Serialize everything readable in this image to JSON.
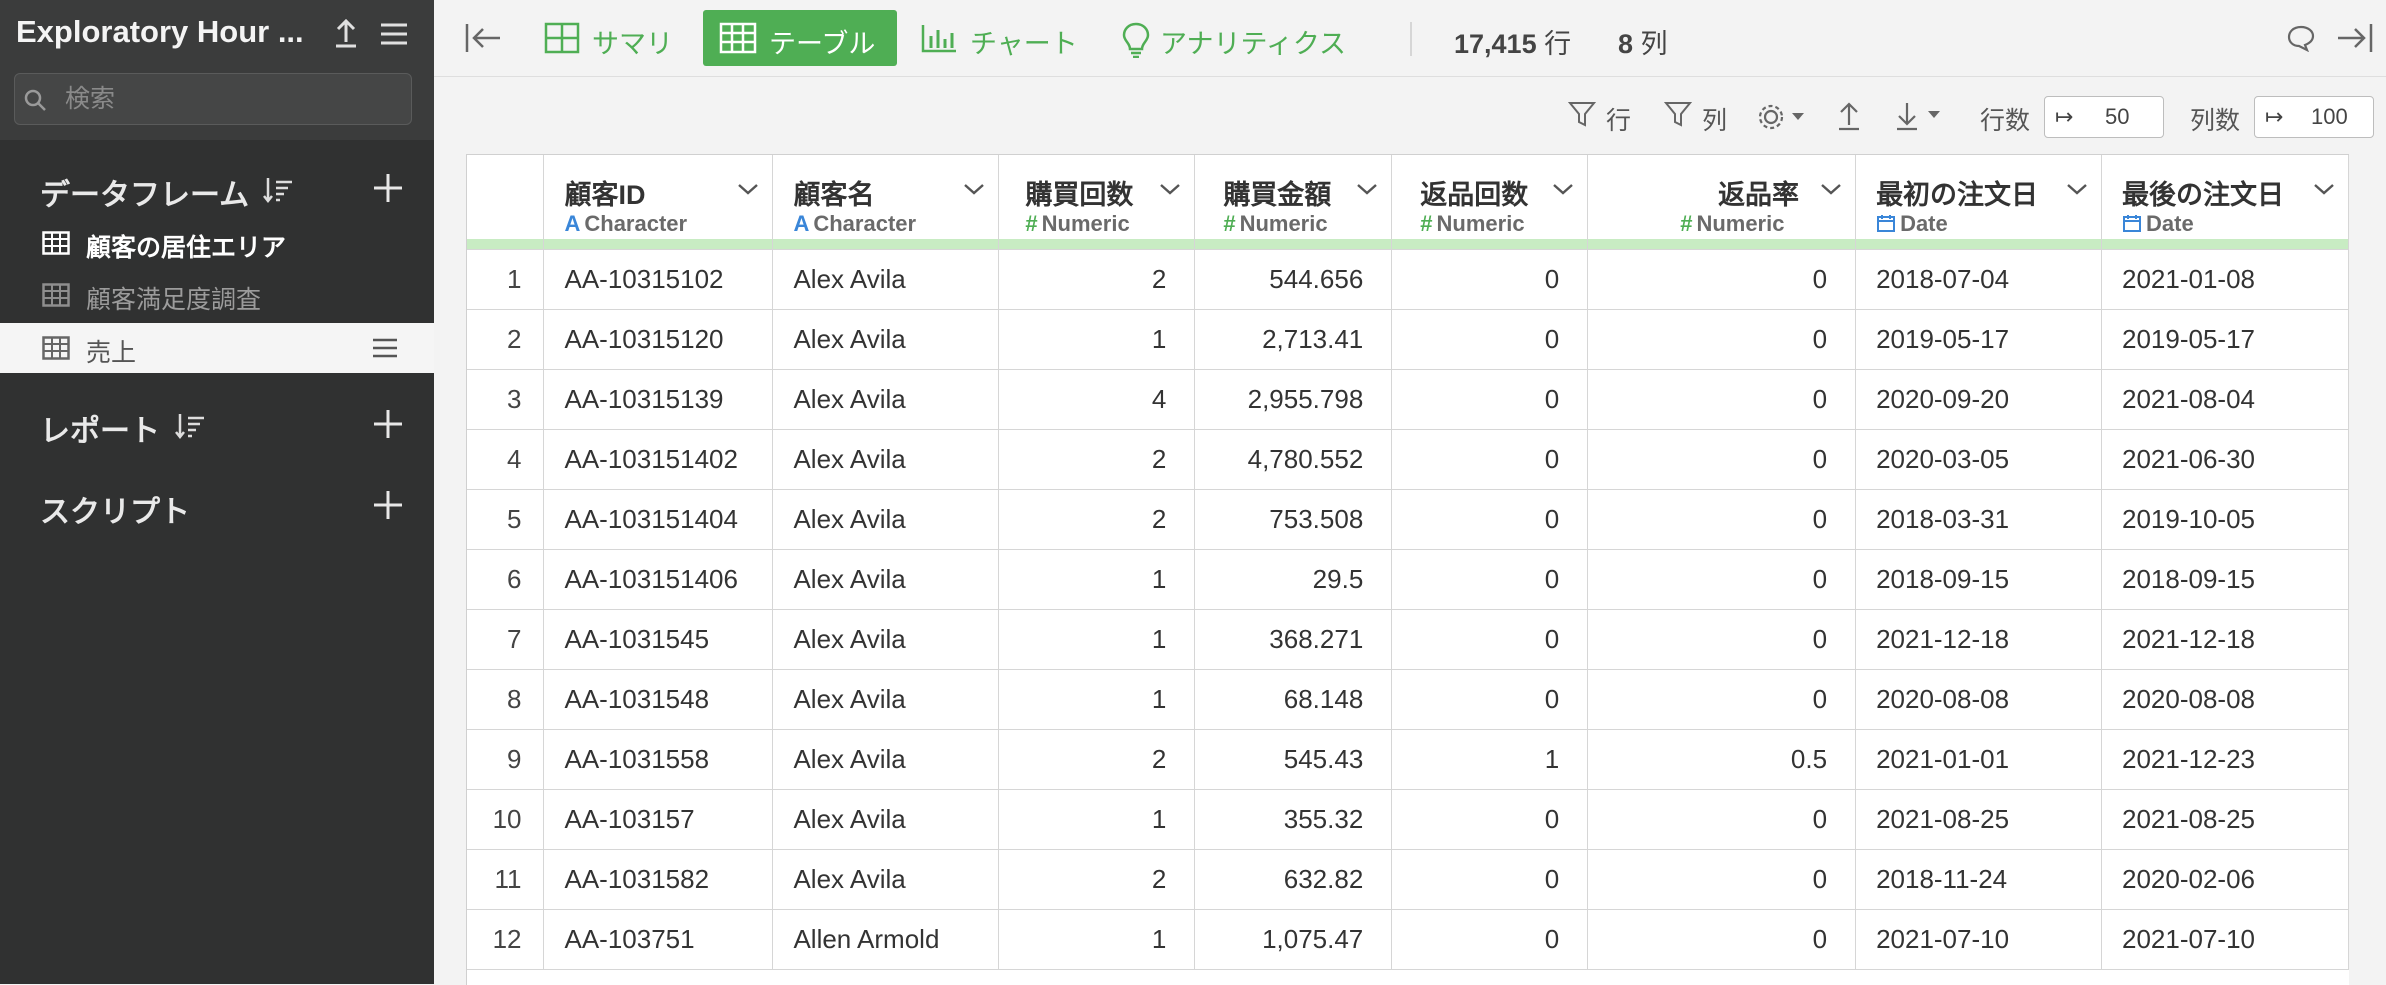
{
  "app": {
    "project_title": "Exploratory Hour ..."
  },
  "sidebar": {
    "search_placeholder": "検索",
    "sections": {
      "dataframes": {
        "title": "データフレーム"
      },
      "reports": {
        "title": "レポート"
      },
      "scripts": {
        "title": "スクリプト"
      }
    },
    "dataframes": [
      {
        "label": "顧客の居住エリア"
      },
      {
        "label": "顧客満足度調査"
      },
      {
        "label": "売上"
      }
    ]
  },
  "toolbar": {
    "tabs": [
      "サマリ",
      "テーブル",
      "チャート",
      "アナリティクス"
    ],
    "active_tab": "テーブル",
    "row_count": "17,415",
    "row_unit": "行",
    "col_count": "8",
    "col_unit": "列"
  },
  "subtoolbar": {
    "row_filter": "行",
    "col_filter": "列",
    "rows_label": "行数",
    "rows_value": "50",
    "cols_label": "列数",
    "cols_value": "100"
  },
  "table": {
    "columns": [
      {
        "name": "顧客ID",
        "type": "Character",
        "type_symbol": "A"
      },
      {
        "name": "顧客名",
        "type": "Character",
        "type_symbol": "A"
      },
      {
        "name": "購買回数",
        "type": "Numeric",
        "type_symbol": "#"
      },
      {
        "name": "購買金額",
        "type": "Numeric",
        "type_symbol": "#"
      },
      {
        "name": "返品回数",
        "type": "Numeric",
        "type_symbol": "#"
      },
      {
        "name": "返品率",
        "type": "Numeric",
        "type_symbol": "#"
      },
      {
        "name": "最初の注文日",
        "type": "Date",
        "type_symbol": "date"
      },
      {
        "name": "最後の注文日",
        "type": "Date",
        "type_symbol": "date"
      }
    ],
    "rows": [
      [
        "1",
        "AA-10315102",
        "Alex Avila",
        "2",
        "544.656",
        "0",
        "0",
        "2018-07-04",
        "2021-01-08"
      ],
      [
        "2",
        "AA-10315120",
        "Alex Avila",
        "1",
        "2,713.41",
        "0",
        "0",
        "2019-05-17",
        "2019-05-17"
      ],
      [
        "3",
        "AA-10315139",
        "Alex Avila",
        "4",
        "2,955.798",
        "0",
        "0",
        "2020-09-20",
        "2021-08-04"
      ],
      [
        "4",
        "AA-103151402",
        "Alex Avila",
        "2",
        "4,780.552",
        "0",
        "0",
        "2020-03-05",
        "2021-06-30"
      ],
      [
        "5",
        "AA-103151404",
        "Alex Avila",
        "2",
        "753.508",
        "0",
        "0",
        "2018-03-31",
        "2019-10-05"
      ],
      [
        "6",
        "AA-103151406",
        "Alex Avila",
        "1",
        "29.5",
        "0",
        "0",
        "2018-09-15",
        "2018-09-15"
      ],
      [
        "7",
        "AA-1031545",
        "Alex Avila",
        "1",
        "368.271",
        "0",
        "0",
        "2021-12-18",
        "2021-12-18"
      ],
      [
        "8",
        "AA-1031548",
        "Alex Avila",
        "1",
        "68.148",
        "0",
        "0",
        "2020-08-08",
        "2020-08-08"
      ],
      [
        "9",
        "AA-1031558",
        "Alex Avila",
        "2",
        "545.43",
        "1",
        "0.5",
        "2021-01-01",
        "2021-12-23"
      ],
      [
        "10",
        "AA-103157",
        "Alex Avila",
        "1",
        "355.32",
        "0",
        "0",
        "2021-08-25",
        "2021-08-25"
      ],
      [
        "11",
        "AA-1031582",
        "Alex Avila",
        "2",
        "632.82",
        "0",
        "0",
        "2018-11-24",
        "2020-02-06"
      ],
      [
        "12",
        "AA-103751",
        "Allen Armold",
        "1",
        "1,075.47",
        "0",
        "0",
        "2021-07-10",
        "2021-07-10"
      ]
    ]
  },
  "colors": {
    "accent_green": "#4fae54",
    "sidebar_bg": "#303131",
    "type_blue": "#3a86d8",
    "type_green": "#4fae54",
    "header_bar": "#c8ecc3"
  }
}
